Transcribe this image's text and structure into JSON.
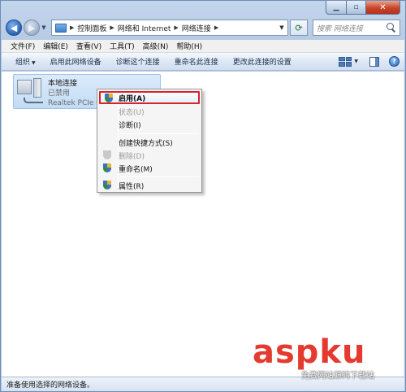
{
  "address": {
    "breadcrumbs": [
      "控制面板",
      "网络和 Internet",
      "网络连接"
    ]
  },
  "search": {
    "placeholder": "搜索 网络连接"
  },
  "menubar": {
    "items": [
      "文件(F)",
      "编辑(E)",
      "查看(V)",
      "工具(T)",
      "高级(N)",
      "帮助(H)"
    ]
  },
  "commandbar": {
    "items": [
      "组织",
      "启用此网络设备",
      "诊断这个连接",
      "重命名此连接",
      "更改此连接的设置"
    ]
  },
  "connection": {
    "name": "本地连接",
    "status": "已禁用",
    "adapter": "Realtek PCIe G"
  },
  "context_menu": {
    "items": [
      {
        "label": "启用(A)",
        "icon": "shield-icon",
        "enabled": true,
        "highlighted": true
      },
      {
        "label": "状态(U)",
        "icon": "",
        "enabled": false
      },
      {
        "label": "诊断(I)",
        "icon": "",
        "enabled": true
      },
      {
        "label": "创建快捷方式(S)",
        "icon": "",
        "enabled": true
      },
      {
        "label": "删除(D)",
        "icon": "shield-icon",
        "enabled": false
      },
      {
        "label": "重命名(M)",
        "icon": "shield-icon",
        "enabled": true
      },
      {
        "label": "属性(R)",
        "icon": "shield-icon",
        "enabled": true
      }
    ],
    "highlight_color": "#d9222a"
  },
  "statusbar": {
    "text": "准备使用选择的网络设备。"
  },
  "watermark": {
    "logo": "aspku",
    "subtitle": "免费网站源码下载站"
  },
  "colors": {
    "accent": "#2b63b6",
    "close": "#c7452a"
  }
}
